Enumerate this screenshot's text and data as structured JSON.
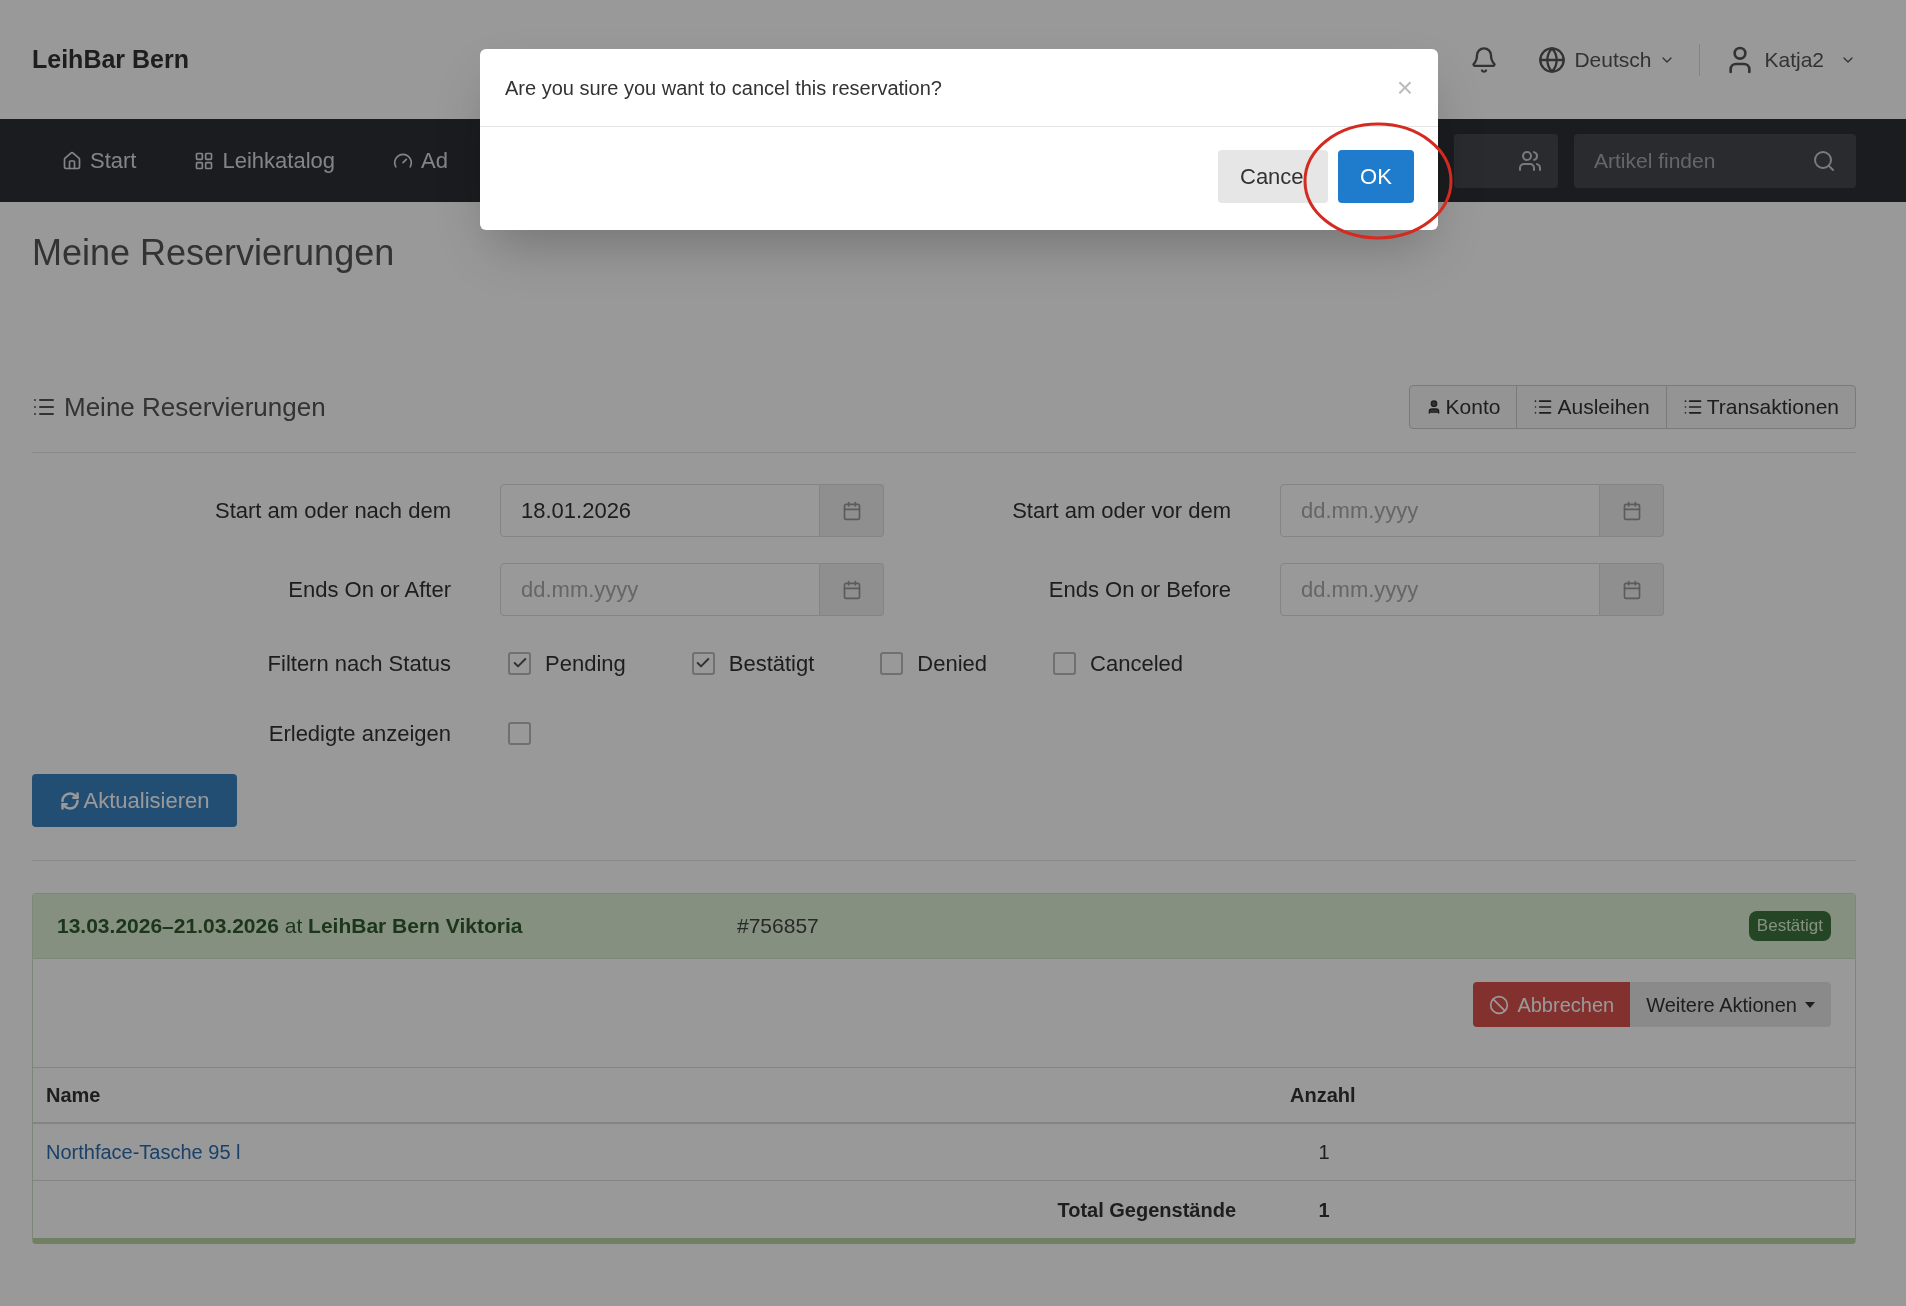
{
  "header": {
    "brand": "LeihBar Bern",
    "language": "Deutsch",
    "user": "Katja2"
  },
  "nav": {
    "items": [
      {
        "label": "Start"
      },
      {
        "label": "Leihkatalog"
      },
      {
        "label": "Ad"
      }
    ],
    "search": {
      "placeholder": "Artikel finden"
    }
  },
  "page_title": "Meine Reservierungen",
  "panel": {
    "title": "Meine Reservierungen",
    "buttons": [
      "Konto",
      "Ausleihen",
      "Transaktionen"
    ]
  },
  "filters": {
    "date_fields": [
      {
        "label": "Start am oder nach dem",
        "value": "18.01.2026"
      },
      {
        "label": "Start am oder vor dem",
        "placeholder": "dd.mm.yyyy"
      },
      {
        "label": "Ends On or After",
        "placeholder": "dd.mm.yyyy"
      },
      {
        "label": "Ends On or Before",
        "placeholder": "dd.mm.yyyy"
      }
    ],
    "status_label": "Filtern nach Status",
    "statuses": [
      {
        "label": "Pending",
        "checked": true
      },
      {
        "label": "Bestätigt",
        "checked": true
      },
      {
        "label": "Denied",
        "checked": false
      },
      {
        "label": "Canceled",
        "checked": false
      }
    ],
    "show_done": {
      "label": "Erledigte anzeigen",
      "checked": false
    },
    "refresh_button": "Aktualisieren"
  },
  "reservation": {
    "heading": "**13.03.2026–21.03.2026** at **LeihBar Bern Viktoria**",
    "number": "#756857",
    "status": "Bestätigt",
    "actions": {
      "cancel": "Abbrechen",
      "more": "Weitere Aktionen"
    },
    "table": {
      "columns": [
        "Name",
        "Anzahl"
      ],
      "rows": [
        {
          "name": "Northface-Tasche 95 l",
          "count": "1"
        }
      ],
      "total": {
        "label": "Total Gegenstände",
        "value": "1"
      }
    }
  },
  "dialog": {
    "message": "Are you sure you want to cancel this reservation?",
    "close": "×",
    "buttons": [
      {
        "label": "Cance",
        "kind": "default"
      },
      {
        "label": "OK",
        "kind": "primary"
      }
    ]
  }
}
